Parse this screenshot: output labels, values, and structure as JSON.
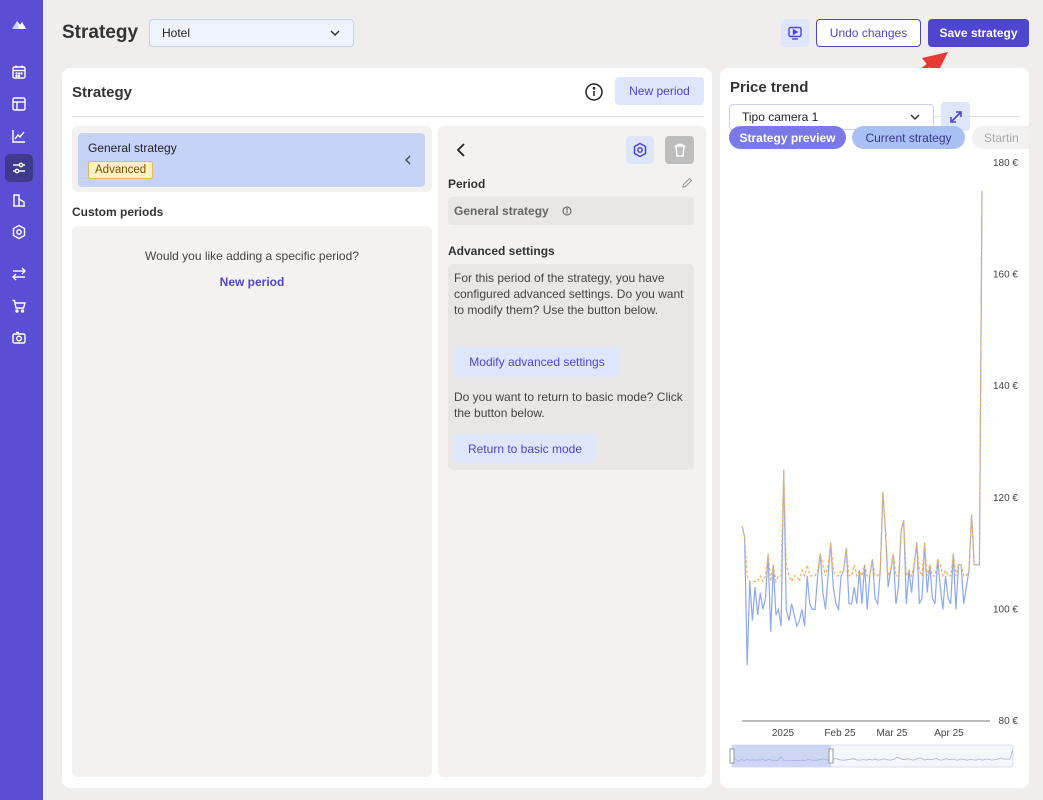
{
  "sidebar": {
    "items": [
      {
        "icon": "logo-icon"
      },
      {
        "icon": "calendar-icon"
      },
      {
        "icon": "layout-icon"
      },
      {
        "icon": "line-chart-icon"
      },
      {
        "icon": "sliders-icon",
        "active": true
      },
      {
        "icon": "building-icon"
      },
      {
        "icon": "hexagon-settings-icon"
      },
      {
        "icon": "transfer-icon"
      },
      {
        "icon": "cart-icon"
      },
      {
        "icon": "camera-icon"
      }
    ]
  },
  "header": {
    "title": "Strategy",
    "hotel_select": "Hotel",
    "undo_label": "Undo changes",
    "save_label": "Save strategy"
  },
  "strategy_panel": {
    "title": "Strategy",
    "new_period_label": "New period",
    "general_strategy": "General strategy",
    "badge": "Advanced",
    "custom_periods_title": "Custom periods",
    "empty_message": "Would you like adding a specific period?",
    "empty_link": "New period",
    "period_label": "Period",
    "period_value": "General strategy",
    "advanced_title": "Advanced settings",
    "advanced_text": "For this period of the strategy, you have configured advanced settings. Do you want to modify them? Use the button below.",
    "modify_label": "Modify advanced settings",
    "basic_text": "Do you want to return to basic mode? Click the button below.",
    "basic_label": "Return to basic mode"
  },
  "trend_panel": {
    "title": "Price trend",
    "room_select": "Tipo camera 1",
    "chips": [
      "Strategy preview",
      "Current strategy",
      "Startin"
    ],
    "colors": {
      "preview": "#7b78e8",
      "current": "#a9c0f5",
      "line_orange": "#f2b35c",
      "line_blue": "#8ea8f0"
    }
  },
  "chart_data": {
    "type": "line",
    "y_ticks": [
      "180 €",
      "160 €",
      "140 €",
      "120 €",
      "100 €",
      "80 €"
    ],
    "x_ticks": [
      "2025",
      "Feb 25",
      "Mar 25",
      "Apr 25"
    ],
    "ylim": [
      80,
      180
    ],
    "series": [
      {
        "name": "Strategy preview",
        "values": [
          115,
          113,
          106,
          105,
          105,
          105,
          105,
          106,
          105,
          106,
          110,
          105,
          108,
          105,
          106,
          106,
          125,
          108,
          106,
          105,
          106,
          106,
          105,
          107,
          106,
          108,
          106,
          106,
          106,
          107,
          110,
          108,
          106,
          108,
          112,
          107,
          106,
          106,
          107,
          107,
          111,
          106,
          106,
          108,
          106,
          107,
          106,
          108,
          106,
          106,
          109,
          106,
          106,
          107,
          121,
          114,
          106,
          107,
          110,
          106,
          106,
          114,
          116,
          106,
          107,
          106,
          108,
          112,
          107,
          106,
          112,
          106,
          108,
          106,
          106,
          109,
          108,
          106,
          107,
          106,
          106,
          110,
          106,
          108,
          108,
          106,
          106,
          107,
          117,
          108,
          108,
          108,
          175
        ]
      },
      {
        "name": "Current strategy",
        "values": [
          115,
          113,
          90,
          105,
          98,
          104,
          99,
          103,
          100,
          102,
          110,
          96,
          108,
          99,
          100,
          97,
          125,
          100,
          98,
          101,
          99,
          97,
          98,
          100,
          97,
          106,
          101,
          100,
          100,
          106,
          110,
          103,
          100,
          106,
          112,
          104,
          101,
          100,
          106,
          107,
          111,
          101,
          101,
          104,
          101,
          107,
          101,
          108,
          100,
          106,
          109,
          102,
          101,
          107,
          121,
          114,
          104,
          107,
          110,
          101,
          104,
          114,
          116,
          101,
          107,
          103,
          108,
          112,
          101,
          102,
          112,
          103,
          108,
          102,
          101,
          109,
          104,
          100,
          106,
          102,
          101,
          110,
          100,
          108,
          108,
          101,
          104,
          107,
          117,
          108,
          108,
          108,
          175
        ]
      }
    ]
  }
}
